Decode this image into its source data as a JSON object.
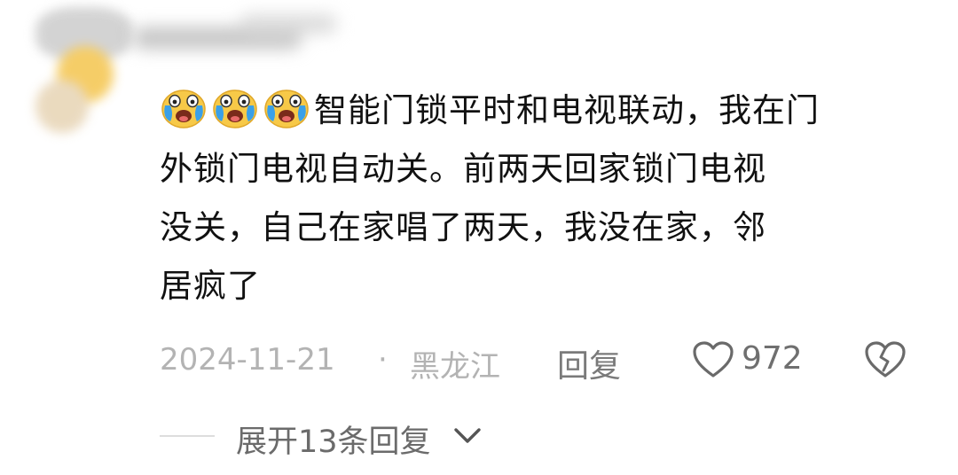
{
  "comment": {
    "emoji": [
      "crying-face",
      "crying-face",
      "crying-face"
    ],
    "lines": [
      "智能门锁平时和电视联动，我在门",
      "外锁门电视自动关。前两天回家锁门电视",
      "没关，自己在家唱了两天，我没在家，邻",
      "居疯了"
    ]
  },
  "meta": {
    "date": "2024-11-21",
    "separator": "·",
    "location": "黑龙江",
    "reply_label": "回复",
    "like_count": "972"
  },
  "replies": {
    "expand_label": "展开13条回复"
  },
  "colors": {
    "text": "#111111",
    "meta_text": "#b3b3b3",
    "action_text": "#6f6f6f",
    "emoji_yellow": "#f7c948",
    "emoji_tears": "#3aa0e8"
  }
}
